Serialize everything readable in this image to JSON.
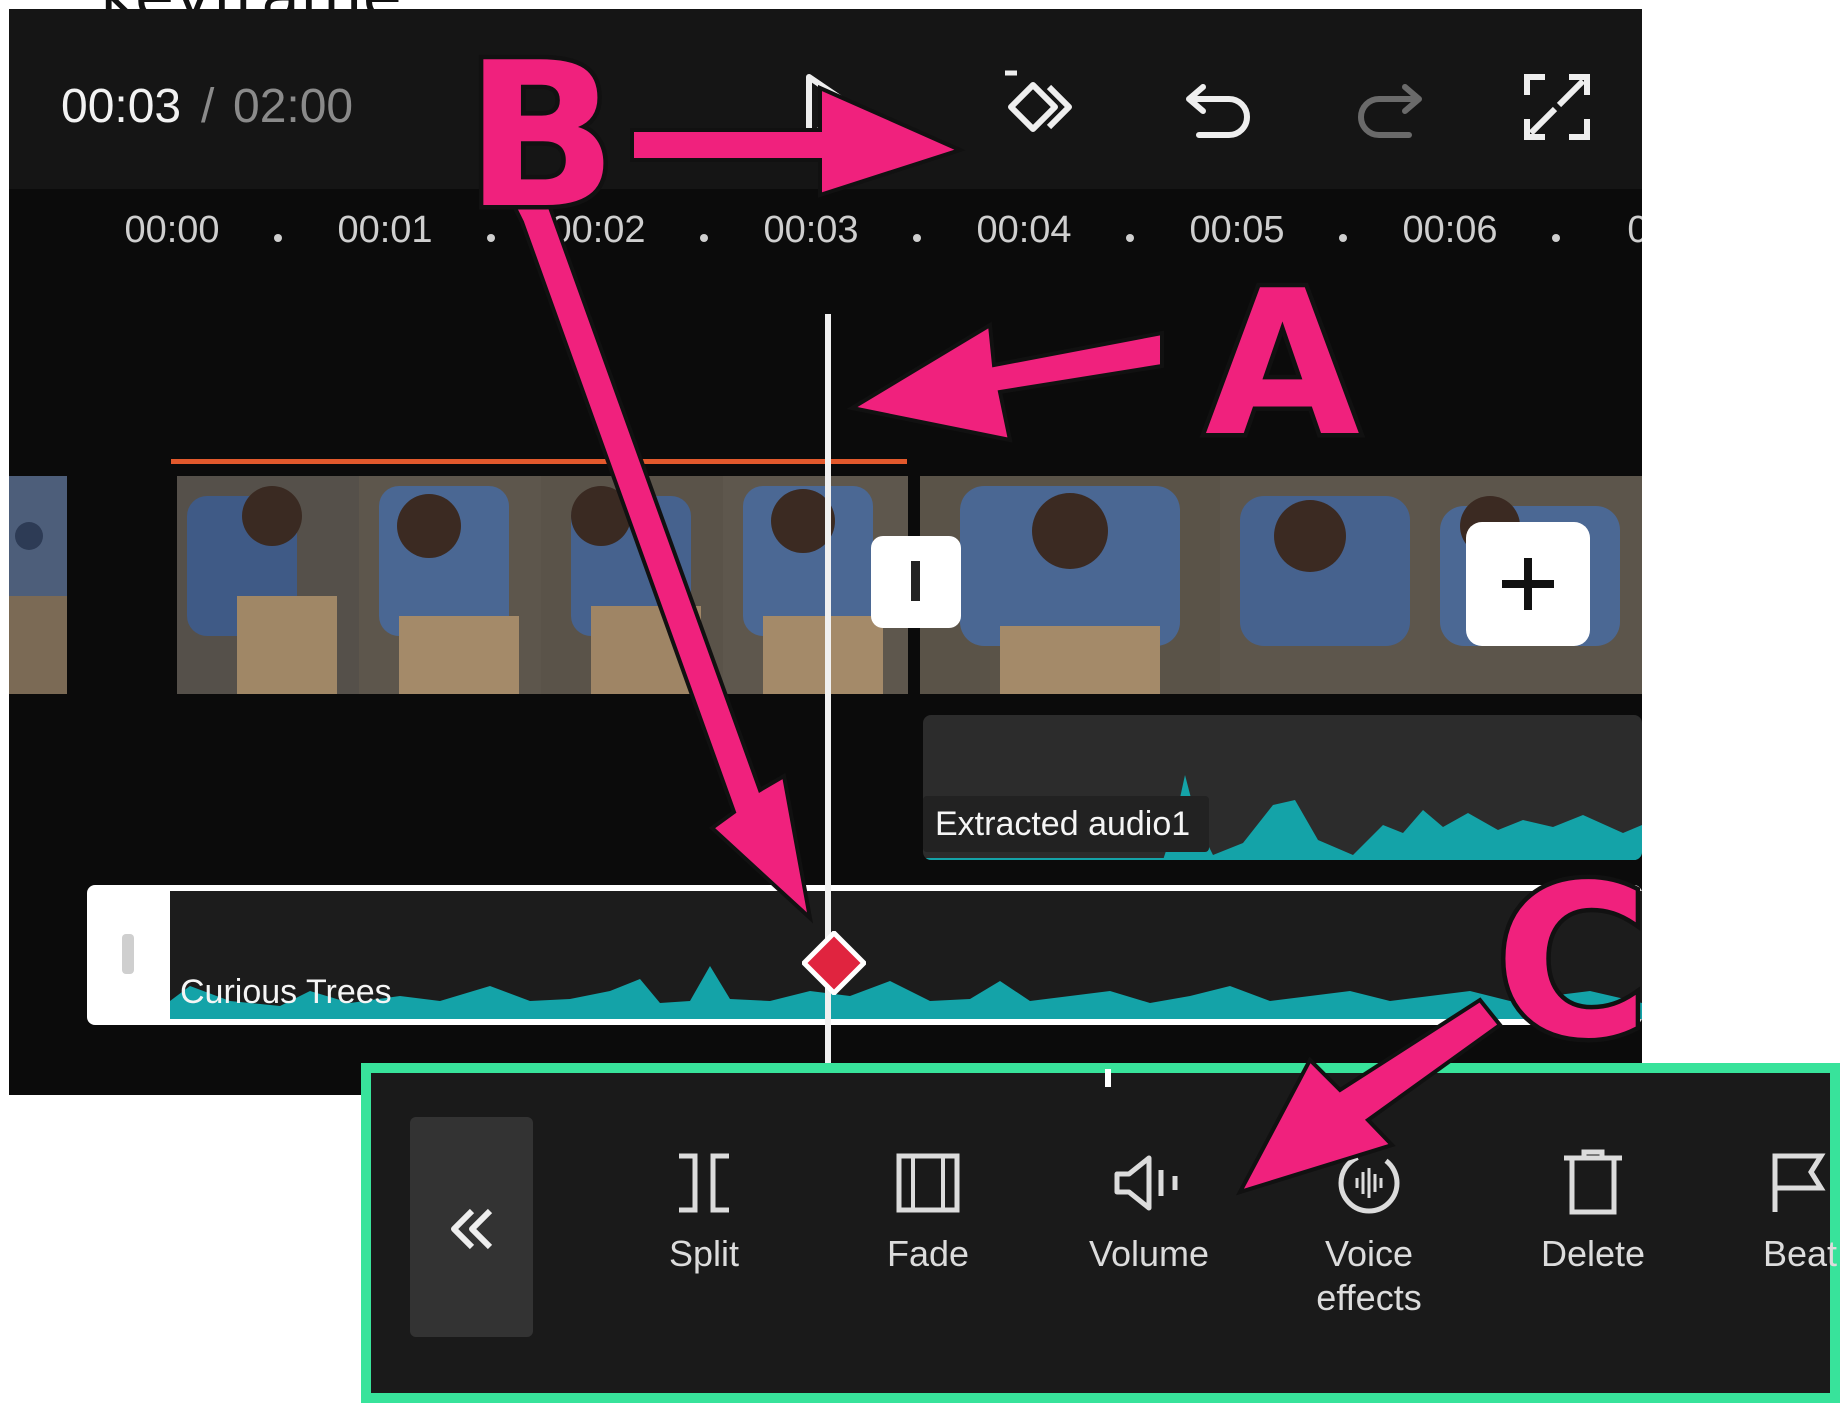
{
  "caption": {
    "partial_text": "keyframe"
  },
  "player": {
    "current_time": "00:03",
    "separator": "/",
    "total_time": "02:00"
  },
  "toolbar_icons": [
    "play-icon",
    "keyframe-add-icon",
    "undo-icon",
    "redo-icon",
    "fullscreen-icon"
  ],
  "ruler": {
    "labels": [
      "00:00",
      "00:01",
      "00:02",
      "00:03",
      "00:04",
      "00:05",
      "00:06",
      "0"
    ]
  },
  "tracks": {
    "extracted_audio": {
      "label": "Extracted audio1"
    },
    "music": {
      "label": "Curious Trees"
    }
  },
  "annotations": {
    "a": "A",
    "b": "B",
    "c": "C",
    "accent": "#f0217d",
    "panel_border": "#38e39b"
  },
  "tools": [
    {
      "label": "Split",
      "icon": "split-icon"
    },
    {
      "label": "Fade",
      "icon": "fade-icon"
    },
    {
      "label": "Volume",
      "icon": "volume-icon"
    },
    {
      "label": "Voice\neffects",
      "icon": "voice-effects-icon"
    },
    {
      "label": "Delete",
      "icon": "delete-icon"
    },
    {
      "label": "Beat",
      "icon": "beat-flag-icon"
    }
  ]
}
